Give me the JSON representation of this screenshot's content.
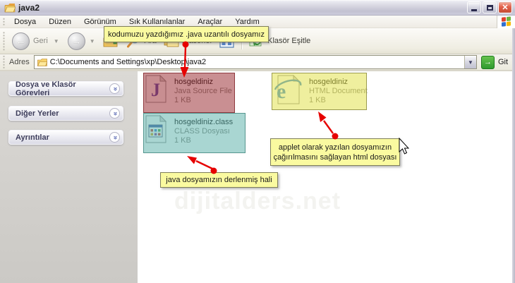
{
  "window": {
    "title": "java2"
  },
  "menu": {
    "items": [
      "Dosya",
      "Düzen",
      "Görünüm",
      "Sık Kullanılanlar",
      "Araçlar",
      "Yardım"
    ]
  },
  "toolbar": {
    "back_label": "Geri",
    "search_label": "Ara",
    "folders_label": "Klasörler",
    "sync_label": "Klasör Eşitle"
  },
  "address": {
    "label": "Adres",
    "path": "C:\\Documents and Settings\\xp\\Desktop\\java2",
    "go_label": "Git"
  },
  "sidebar": {
    "panels": [
      {
        "label": "Dosya ve Klasör Görevleri"
      },
      {
        "label": "Diğer Yerler"
      },
      {
        "label": "Ayrıntılar"
      }
    ]
  },
  "files": [
    {
      "name": "hosgeldiniz",
      "type": "Java Source File",
      "size": "1 KB",
      "icon": "java-source-icon",
      "highlight": "#9d3339"
    },
    {
      "name": "hosgeldiniz.class",
      "type": "CLASS Dosyası",
      "size": "1 KB",
      "icon": "class-file-icon",
      "highlight": "#63b4ad"
    },
    {
      "name": "hosgeldiniz",
      "type": "HTML Document",
      "size": "1 KB",
      "icon": "html-ie-icon",
      "highlight": "#e2e24f"
    }
  ],
  "annotations": {
    "java_note": "kodumuzu yazdığımız .java uzantılı dosyamız",
    "class_note": "java dosyamızın derlenmiş hali",
    "html_note_line1": "applet olarak yazılan dosyamızın",
    "html_note_line2": "çağırılmasını sağlayan html dosyası"
  },
  "watermark": {
    "text": "dijitalders.net"
  },
  "colors": {
    "red_highlight": "#9d3339",
    "teal_highlight": "#63b4ad",
    "yellow_highlight": "#e2e24f",
    "annotation_bg": "#fafaa0",
    "arrow": "#e60000"
  }
}
